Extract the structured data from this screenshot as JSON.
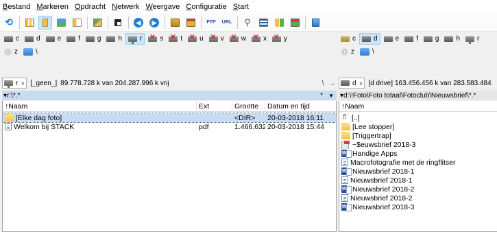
{
  "menu": [
    {
      "label": "Bestand",
      "key": "B",
      "rest": "estand"
    },
    {
      "label": "Markeren",
      "key": "M",
      "rest": "arkeren"
    },
    {
      "label": "Opdracht",
      "key": "O",
      "rest": "pdracht"
    },
    {
      "label": "Netwerk",
      "key": "N",
      "rest": "etwerk"
    },
    {
      "label": "Weergave",
      "key": "W",
      "rest": "eergave"
    },
    {
      "label": "Configuratie",
      "key": "C",
      "rest": "onfiguratie"
    },
    {
      "label": "Start",
      "key": "S",
      "rest": "tart"
    }
  ],
  "toolbar": {
    "ftp_label": "FTP",
    "url_label": "URL"
  },
  "left": {
    "drives": [
      {
        "letter": "c",
        "kind": "hd"
      },
      {
        "letter": "d",
        "kind": "hd"
      },
      {
        "letter": "e",
        "kind": "hd"
      },
      {
        "letter": "f",
        "kind": "hd"
      },
      {
        "letter": "g",
        "kind": "hd"
      },
      {
        "letter": "h",
        "kind": "hd"
      },
      {
        "letter": "r",
        "kind": "net",
        "selected": true
      },
      {
        "letter": "s",
        "kind": "dis"
      },
      {
        "letter": "t",
        "kind": "dis"
      },
      {
        "letter": "u",
        "kind": "dis"
      },
      {
        "letter": "v",
        "kind": "dis"
      },
      {
        "letter": "w",
        "kind": "dis"
      },
      {
        "letter": "x",
        "kind": "dis"
      },
      {
        "letter": "y",
        "kind": "dis"
      }
    ],
    "drives2": [
      {
        "letter": "z",
        "kind": "disc"
      },
      {
        "letter": "\\",
        "kind": "netw"
      }
    ],
    "combo_drive": "r",
    "volume": "[_geen_]",
    "free": "89.778.728 k van 204.287.996 k vrij",
    "nav_root": "\\",
    "nav_up": "..",
    "filter_star": "*",
    "filter_arrow": "▼",
    "path": "▾r:\\*.*",
    "columns": {
      "name": "↑Naam",
      "ext": "Ext",
      "size": "Grootte",
      "date": "Datum en tijd"
    },
    "files": [
      {
        "name": "[Elke dag foto]",
        "ext": "",
        "size": "<DIR>",
        "date": "20-03-2018 16:11",
        "icon": "folder",
        "selected": true
      },
      {
        "name": "Welkom bij STACK",
        "ext": "pdf",
        "size": "1.466.632",
        "date": "20-03-2018 15:44",
        "icon": "doc"
      }
    ]
  },
  "right": {
    "drives": [
      {
        "letter": "c",
        "kind": "usb"
      },
      {
        "letter": "d",
        "kind": "hd",
        "selected": true
      },
      {
        "letter": "e",
        "kind": "hd"
      },
      {
        "letter": "f",
        "kind": "hd"
      },
      {
        "letter": "g",
        "kind": "hd"
      },
      {
        "letter": "h",
        "kind": "hd"
      },
      {
        "letter": "r",
        "kind": "net"
      }
    ],
    "drives2": [
      {
        "letter": "z",
        "kind": "disc"
      },
      {
        "letter": "\\",
        "kind": "netw"
      }
    ],
    "combo_drive": "d",
    "volume": "[d drive]",
    "free": "163.456.456 k van 283.583.484",
    "path": "▾d:\\!Foto\\Foto totaal\\Fotoclub\\Nieuwsbrief\\*.*",
    "columns": {
      "name": "↑Naam"
    },
    "files": [
      {
        "name": "[..]",
        "icon": "up"
      },
      {
        "name": "[Lee stopper]",
        "icon": "folder"
      },
      {
        "name": "[Triggertrap]",
        "icon": "folder"
      },
      {
        "name": "~$euwsbrief 2018-3",
        "icon": "tmp"
      },
      {
        "name": "Handige Apps",
        "icon": "word"
      },
      {
        "name": "Macrofotografie met de ringflitser",
        "icon": "doc"
      },
      {
        "name": "Nieuwsbrief 2018-1",
        "icon": "word"
      },
      {
        "name": "Nieuwsbrief 2018-1",
        "icon": "doc"
      },
      {
        "name": "Nieuwsbrief 2018-2",
        "icon": "word"
      },
      {
        "name": "Nieuwsbrief 2018-2",
        "icon": "doc"
      },
      {
        "name": "Nieuwsbrief 2018-3",
        "icon": "word"
      }
    ]
  },
  "colors": {
    "selection": "#c6dcf5",
    "active_path": "#c8dbf0",
    "folder": "#f2c04a",
    "toolbar_blue": "#1b7fd6"
  }
}
